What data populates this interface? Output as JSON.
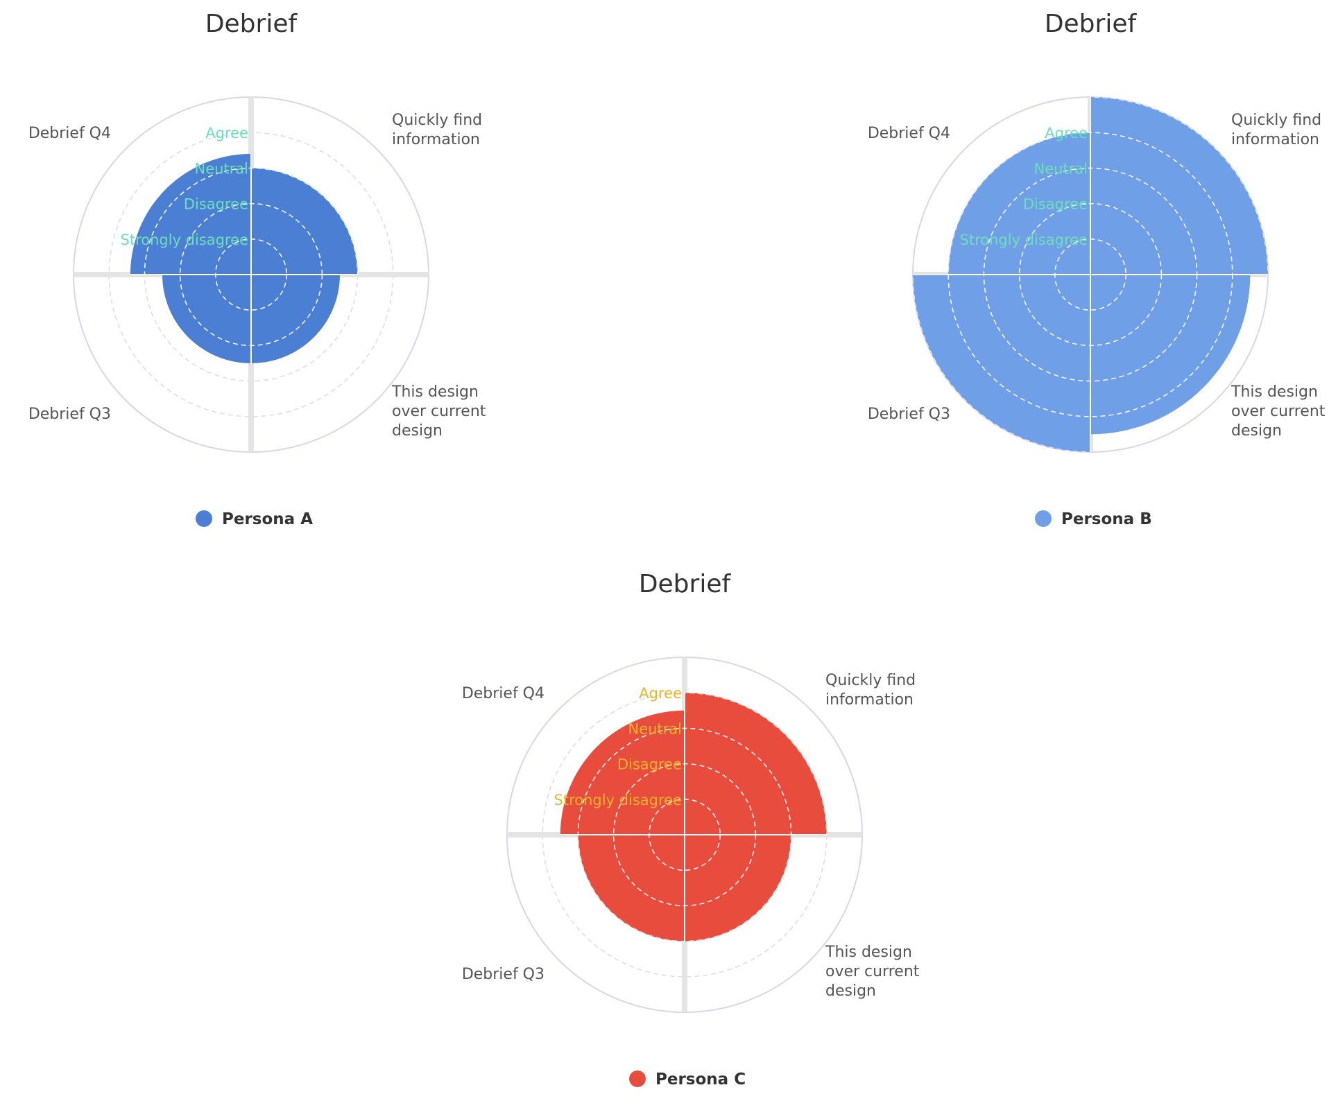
{
  "chart_data": [
    {
      "type": "polar-bar",
      "title": "Debrief",
      "categories": [
        "Quickly find information",
        "This design over current design",
        "Debrief Q3",
        "Debrief Q4"
      ],
      "category_lines": [
        [
          "Quickly find",
          "information"
        ],
        [
          "This design",
          "over current",
          "design"
        ],
        [
          "Debrief Q3"
        ],
        [
          "Debrief Q4"
        ]
      ],
      "levels": [
        "Strongly disagree",
        "Disagree",
        "Neutral",
        "Agree"
      ],
      "rlim": [
        0,
        5
      ],
      "series": [
        {
          "name": "Persona A",
          "values": [
            3,
            2.5,
            2.5,
            3.4
          ]
        }
      ],
      "color": "#4a7fd4",
      "level_label_color": "#6be0b7",
      "grid": true,
      "legend_position": "bottom-center"
    },
    {
      "type": "polar-bar",
      "title": "Debrief",
      "categories": [
        "Quickly find information",
        "This design over current design",
        "Debrief Q3",
        "Debrief Q4"
      ],
      "category_lines": [
        [
          "Quickly find",
          "information"
        ],
        [
          "This design",
          "over current",
          "design"
        ],
        [
          "Debrief Q3"
        ],
        [
          "Debrief Q4"
        ]
      ],
      "levels": [
        "Strongly disagree",
        "Disagree",
        "Neutral",
        "Agree"
      ],
      "rlim": [
        0,
        5
      ],
      "series": [
        {
          "name": "Persona B",
          "values": [
            5,
            4.5,
            5,
            4
          ]
        }
      ],
      "color": "#6f9fe6",
      "level_label_color": "#6be0b7",
      "grid": true,
      "legend_position": "bottom-center"
    },
    {
      "type": "polar-bar",
      "title": "Debrief",
      "categories": [
        "Quickly find information",
        "This design over current design",
        "Debrief Q3",
        "Debrief Q4"
      ],
      "category_lines": [
        [
          "Quickly find",
          "information"
        ],
        [
          "This design",
          "over current",
          "design"
        ],
        [
          "Debrief Q3"
        ],
        [
          "Debrief Q4"
        ]
      ],
      "levels": [
        "Strongly disagree",
        "Disagree",
        "Neutral",
        "Agree"
      ],
      "rlim": [
        0,
        5
      ],
      "series": [
        {
          "name": "Persona C",
          "values": [
            4,
            3,
            3,
            3.5
          ]
        }
      ],
      "color": "#e84c3d",
      "level_label_color": "#f0b429",
      "grid": true,
      "legend_position": "bottom-center"
    }
  ]
}
